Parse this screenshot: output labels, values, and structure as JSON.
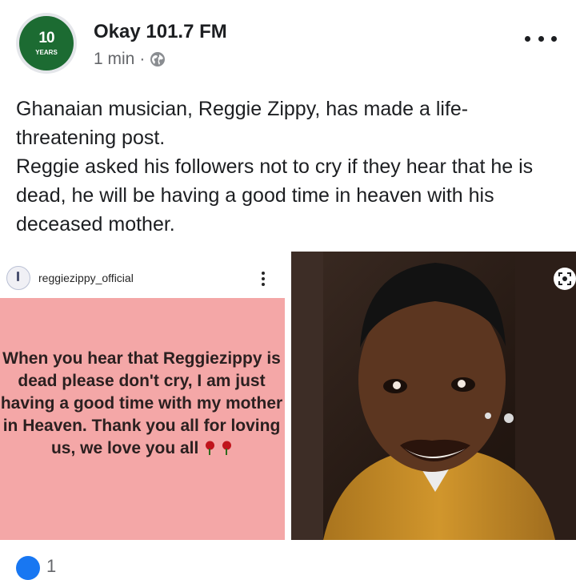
{
  "post": {
    "page_name": "Okay 101.7 FM",
    "avatar": {
      "big_text": "10",
      "sub_text": "YEARS"
    },
    "time": "1 min",
    "separator": "·",
    "privacy_icon": "globe-icon",
    "more_icon": "more-horizontal-icon",
    "text_lines": [
      "Ghanaian musician, Reggie Zippy, has made a life-threatening post.",
      "Reggie asked his followers not to cry if they hear that he is dead, he will be having a good time in heaven with his deceased mother."
    ]
  },
  "images": {
    "left": {
      "username": "reggiezippy_official",
      "quote": "When you hear that Reggiezippy is dead please don't cry, I am just having a good time with my mother in Heaven. Thank you all for loving us, we love you all",
      "emoji": "rose-icon",
      "background": "#f4a7a7"
    },
    "right": {
      "description_icon": "photo-icon"
    }
  },
  "reactions": {
    "icon": "like-icon",
    "count": "1"
  },
  "colors": {
    "text": "#1c1e21",
    "secondary": "#65676b",
    "brand_green": "#1c6b32",
    "accent_blue": "#1877f2"
  }
}
